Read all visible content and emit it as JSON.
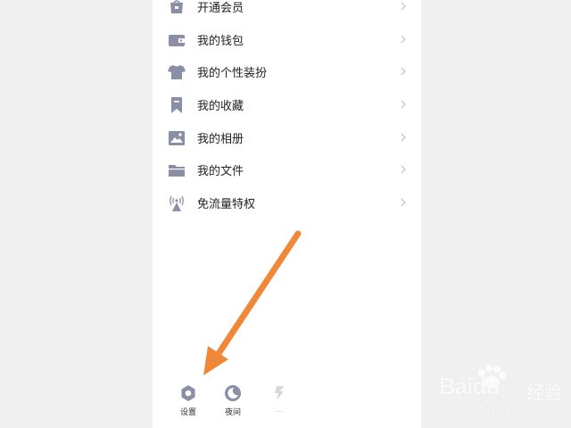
{
  "menu": {
    "items": [
      {
        "label": "开通会员",
        "icon": "vip-bag-icon"
      },
      {
        "label": "我的钱包",
        "icon": "wallet-icon"
      },
      {
        "label": "我的个性装扮",
        "icon": "tshirt-icon"
      },
      {
        "label": "我的收藏",
        "icon": "bookmark-icon"
      },
      {
        "label": "我的相册",
        "icon": "photo-album-icon"
      },
      {
        "label": "我的文件",
        "icon": "folder-icon"
      },
      {
        "label": "免流量特权",
        "icon": "signal-tower-icon"
      }
    ]
  },
  "bottom_bar": {
    "settings_label": "设置",
    "night_label": "夜间",
    "third_label": "…"
  },
  "watermark": {
    "brand": "Baidu",
    "jingyan": "经验",
    "url": "jingyan.baidu.com"
  },
  "colors": {
    "icon": "#8a8fa6",
    "arrow": "#f0883a",
    "text": "#222222",
    "chevron": "#c8c8c8"
  }
}
